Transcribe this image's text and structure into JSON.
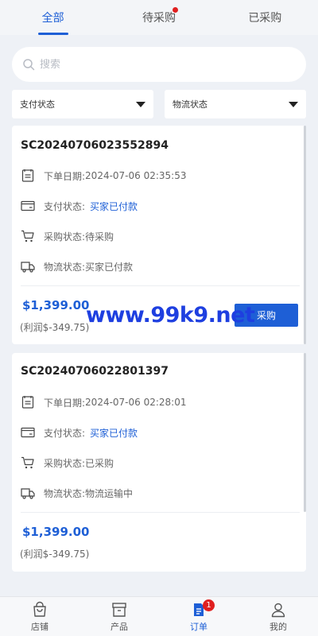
{
  "tabs": [
    {
      "label": "全部",
      "active": true
    },
    {
      "label": "待采购",
      "has_dot": true
    },
    {
      "label": "已采购"
    }
  ],
  "search": {
    "placeholder": "搜索"
  },
  "filters": {
    "payment_status": "支付状态",
    "logistics_status": "物流状态"
  },
  "orders": [
    {
      "order_id": "SC20240706023552894",
      "order_date_label": "下单日期:",
      "order_date": "2024-07-06 02:35:53",
      "payment_label": "支付状态:",
      "payment_value": "买家已付款",
      "purchase_label": "采购状态:",
      "purchase_value": "待采购",
      "logistics_label": "物流状态:",
      "logistics_value": "买家已付款",
      "price": "$1,399.00",
      "profit": "(利润$-349.75)",
      "action_label": "采购"
    },
    {
      "order_id": "SC20240706022801397",
      "order_date_label": "下单日期:",
      "order_date": "2024-07-06 02:28:01",
      "payment_label": "支付状态:",
      "payment_value": "买家已付款",
      "purchase_label": "采购状态:",
      "purchase_value": "已采购",
      "logistics_label": "物流状态:",
      "logistics_value": "物流运输中",
      "price": "$1,399.00",
      "profit": "(利润$-349.75)"
    }
  ],
  "watermark": "www.99k9.net",
  "bottom_nav": [
    {
      "label": "店铺",
      "icon": "shop-bag-icon"
    },
    {
      "label": "产品",
      "icon": "box-icon"
    },
    {
      "label": "订单",
      "icon": "order-list-icon",
      "active": true,
      "badge": "1"
    },
    {
      "label": "我的",
      "icon": "person-icon"
    }
  ],
  "colors": {
    "accent": "#1e5fd6",
    "badge": "#e02020",
    "background": "#eef1f6"
  }
}
